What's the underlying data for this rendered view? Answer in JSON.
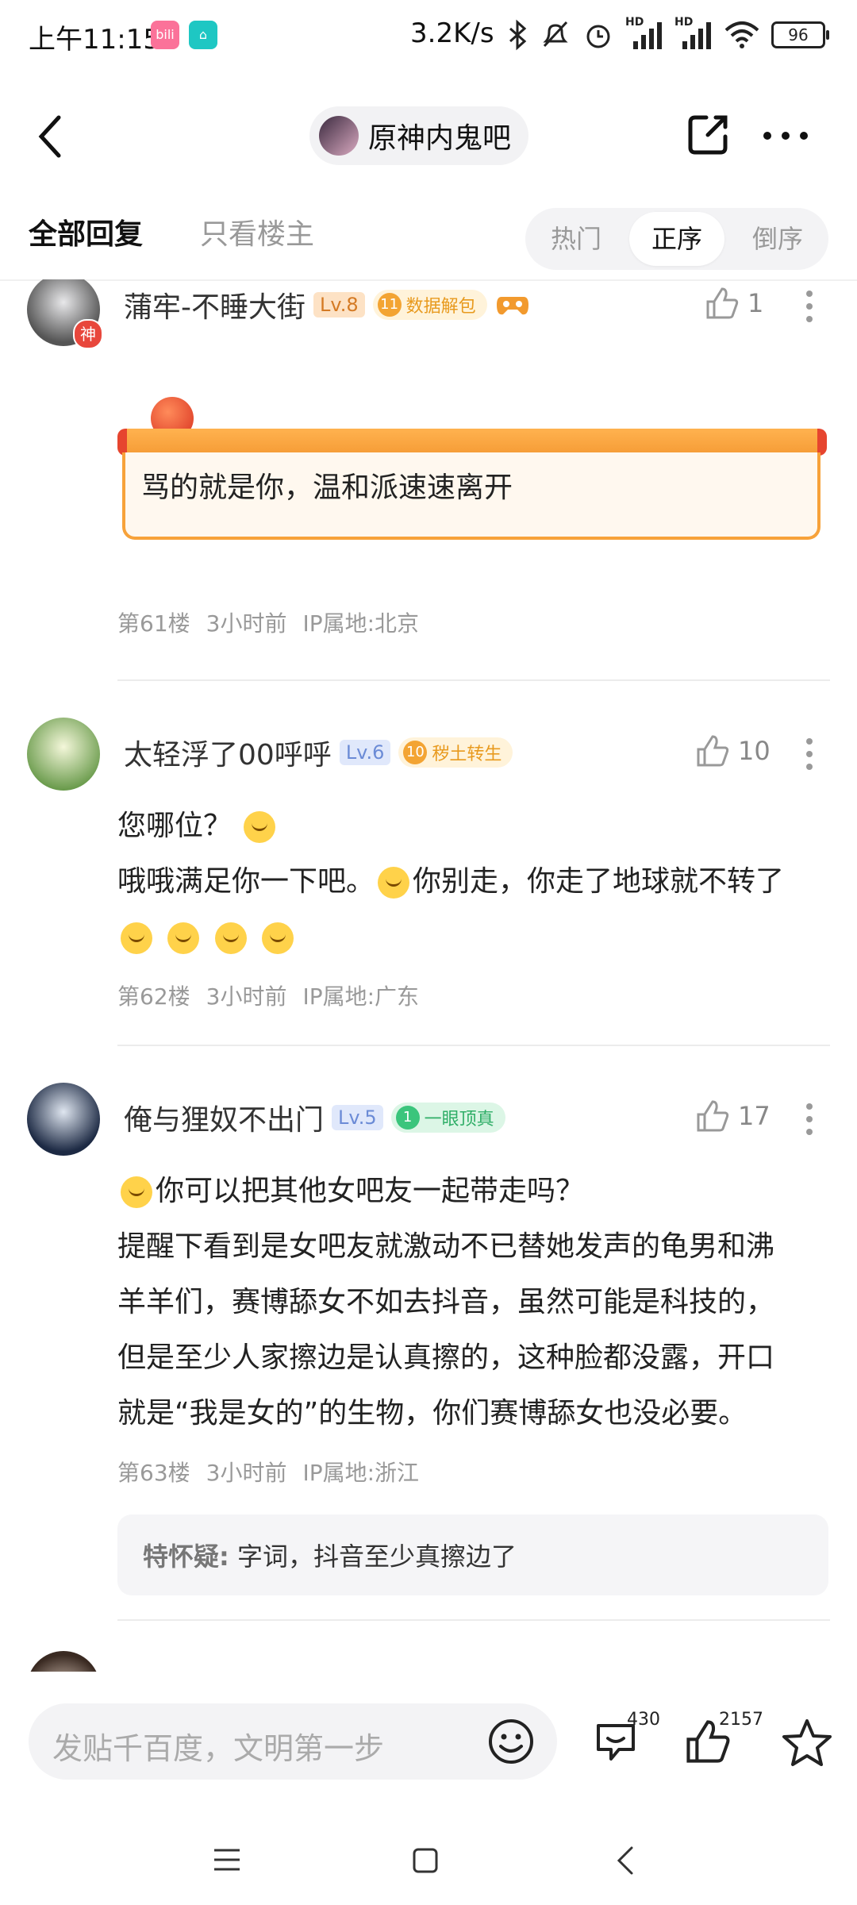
{
  "status_bar": {
    "time": "上午11:15",
    "net_speed": "3.2K/s",
    "battery": "96",
    "signal1": "HD",
    "signal2": "HD"
  },
  "header": {
    "forum_name": "原神内鬼吧"
  },
  "tabs": {
    "all_replies": "全部回复",
    "only_host": "只看楼主",
    "sort": [
      "热门",
      "正序",
      "倒序"
    ],
    "sort_selected": "正序"
  },
  "posts": [
    {
      "user": "蒲牢-不睡大街",
      "level": "Lv.8",
      "badge_num": "11",
      "badge_text": "数据解包",
      "avatar_tag": "神",
      "likes": "1",
      "content": "骂的就是你，温和派速速离开",
      "floor": "第61楼",
      "time": "3小时前",
      "ip": "IP属地:北京"
    },
    {
      "user": "太轻浮了00呼呼",
      "level": "Lv.6",
      "badge_num": "10",
      "badge_text": "秽土转生",
      "likes": "10",
      "lines": [
        "您哪位？",
        "哦哦满足你一下吧。",
        "你别走，你走了地球就不转了"
      ],
      "floor": "第62楼",
      "time": "3小时前",
      "ip": "IP属地:广东"
    },
    {
      "user": "俺与狸奴不出门",
      "level": "Lv.5",
      "badge_num": "1",
      "badge_text": "一眼顶真",
      "likes": "17",
      "lines": [
        "你可以把其他女吧友一起带走吗？",
        "提醒下看到是女吧友就激动不已替她发声的龟男和沸",
        "羊羊们，赛博舔女不如去抖音，虽然可能是科技的，",
        "但是至少人家擦边是认真擦的，这种脸都没露，开口",
        "就是“我是女的”的生物，你们赛博舔女也没必要。"
      ],
      "floor": "第63楼",
      "time": "3小时前",
      "ip": "IP属地:浙江",
      "sub_reply": {
        "user": "特怀疑:",
        "text": "字词，抖音至少真擦边了"
      }
    }
  ],
  "bottom_bar": {
    "placeholder": "发贴千百度，文明第一步",
    "comment_count": "430",
    "like_count": "2157"
  },
  "colors": {
    "accent_gold": "#f3a433",
    "lv_blue": "#6b8bd6",
    "banner_orange": "#f7a23a"
  }
}
